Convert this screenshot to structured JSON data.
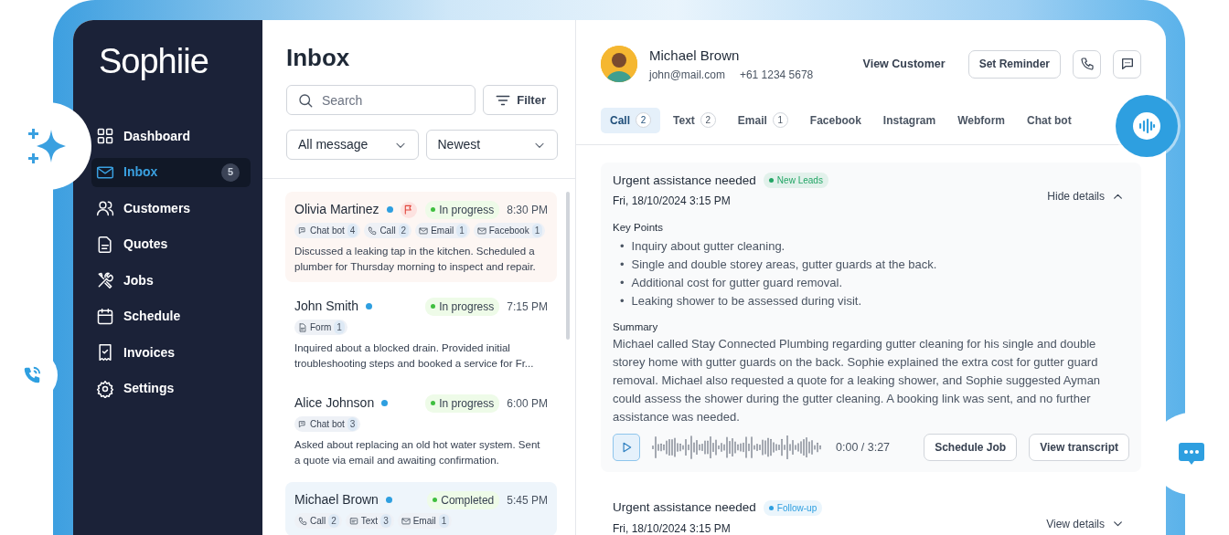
{
  "brand": {
    "logo": "Sophiie"
  },
  "sidebar": {
    "items": [
      {
        "label": "Dashboard",
        "selected": false
      },
      {
        "label": "Inbox",
        "selected": true,
        "badge": "5"
      },
      {
        "label": "Customers",
        "selected": false
      },
      {
        "label": "Quotes",
        "selected": false
      },
      {
        "label": "Jobs",
        "selected": false
      },
      {
        "label": "Schedule",
        "selected": false
      },
      {
        "label": "Invoices",
        "selected": false
      },
      {
        "label": "Settings",
        "selected": false
      }
    ]
  },
  "inbox": {
    "title": "Inbox",
    "search": {
      "placeholder": "Search"
    },
    "filter_button": "Filter",
    "filters": [
      {
        "value": "All message"
      },
      {
        "value": "Newest"
      }
    ],
    "conversations": [
      {
        "name": "Olivia Martinez",
        "unread": true,
        "flagged": true,
        "selected": false,
        "status": "In progress",
        "time": "8:30 PM",
        "channels": [
          {
            "kind": "chatbot",
            "label": "Chat bot",
            "count": "4"
          },
          {
            "kind": "call",
            "label": "Call",
            "count": "2"
          },
          {
            "kind": "email",
            "label": "Email",
            "count": "1"
          },
          {
            "kind": "facebook",
            "label": "Facebook",
            "count": "1"
          }
        ],
        "summary": "Discussed a leaking tap in the kitchen. Scheduled a plumber for Thursday morning to inspect and repair."
      },
      {
        "name": "John Smith",
        "unread": true,
        "flagged": false,
        "selected": false,
        "status": "In progress",
        "time": "7:15 PM",
        "channels": [
          {
            "kind": "form",
            "label": "Form",
            "count": "1"
          }
        ],
        "summary": "Inquired about a blocked drain. Provided initial troubleshooting steps and booked a service for Fr..."
      },
      {
        "name": "Alice Johnson",
        "unread": true,
        "flagged": false,
        "selected": false,
        "status": "In progress",
        "time": "6:00 PM",
        "channels": [
          {
            "kind": "chatbot",
            "label": "Chat bot",
            "count": "3"
          }
        ],
        "summary": "Asked about replacing an old hot water system. Sent a quote via email and awaiting confirmation."
      },
      {
        "name": "Michael Brown",
        "unread": true,
        "flagged": false,
        "selected": true,
        "status": "Completed",
        "time": "5:45 PM",
        "channels": [
          {
            "kind": "call",
            "label": "Call",
            "count": "2"
          },
          {
            "kind": "text",
            "label": "Text",
            "count": "3"
          },
          {
            "kind": "email",
            "label": "Email",
            "count": "1"
          }
        ]
      }
    ]
  },
  "detail": {
    "contact": {
      "name": "Michael Brown",
      "email": "john@mail.com",
      "phone": "+61 1234 5678"
    },
    "view_customer": "View Customer",
    "set_reminder": "Set Reminder",
    "tabs": [
      {
        "label": "Call",
        "count": "2",
        "selected": true
      },
      {
        "label": "Text",
        "count": "2",
        "selected": false
      },
      {
        "label": "Email",
        "count": "1",
        "selected": false
      },
      {
        "label": "Facebook",
        "selected": false
      },
      {
        "label": "Instagram",
        "selected": false
      },
      {
        "label": "Webform",
        "selected": false
      },
      {
        "label": "Chat bot",
        "selected": false
      }
    ],
    "entries": [
      {
        "title": "Urgent assistance needed",
        "tag": {
          "label": "New Leads",
          "color": "#22a565"
        },
        "date": "Fri, 18/10/2024 3:15 PM",
        "toggle": "Hide details",
        "expanded": true,
        "key_points_label": "Key Points",
        "bullet": "•",
        "key_points": [
          "Inquiry about gutter cleaning.",
          "Single and double storey areas, gutter guards at the back.",
          "Additional cost for gutter guard removal.",
          "Leaking shower to be assessed during visit."
        ],
        "summary_label": "Summary",
        "summary": "Michael called Stay Connected Plumbing regarding gutter cleaning for his single and double storey home with gutter guards on the back. Sophie explained the extra cost for gutter guard removal. Michael also requested a quote for a leaking shower, and Sophie suggested Ayman could assess the shower during the gutter cleaning. A booking link was sent, and no further assistance was needed.",
        "player_time": "0:00 / 3:27",
        "buttons": [
          "Schedule Job",
          "View transcript"
        ]
      },
      {
        "title": "Urgent assistance needed",
        "tag": {
          "label": "Follow-up",
          "color": "#2e9fe0"
        },
        "date": "Fri, 18/10/2024 3:15 PM",
        "toggle": "View details",
        "expanded": false
      }
    ]
  }
}
